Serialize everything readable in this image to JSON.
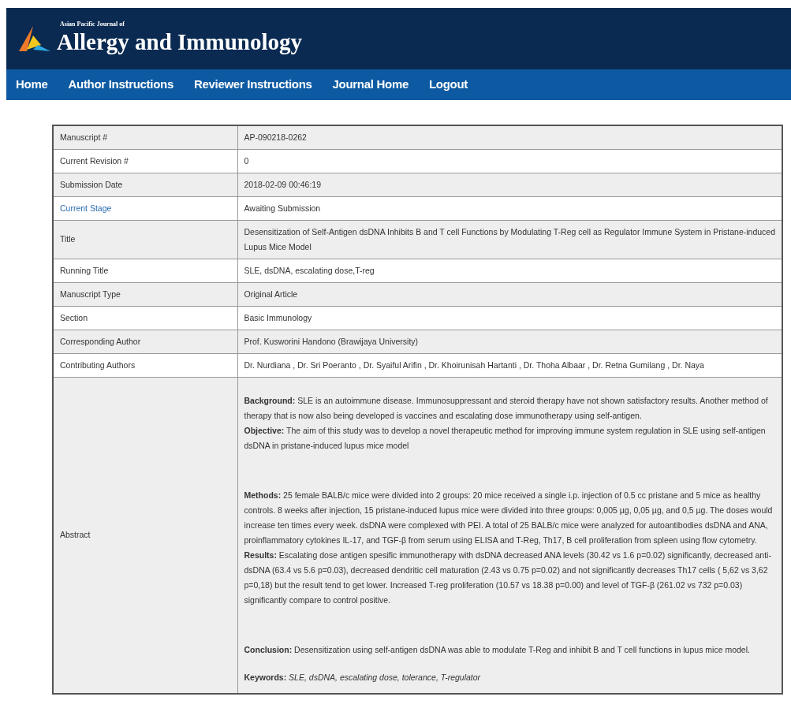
{
  "header": {
    "kicker": "Asian Pacific Journal of",
    "title": "Allergy and Immunology"
  },
  "nav": [
    "Home",
    "Author Instructions",
    "Reviewer Instructions",
    "Journal Home",
    "Logout"
  ],
  "rows": [
    {
      "label": "Manuscript #",
      "kind": "plain",
      "value": "AP-090218-0262"
    },
    {
      "label": "Current Revision #",
      "kind": "plain",
      "value": "0"
    },
    {
      "label": "Submission Date",
      "kind": "plain",
      "value": "2018-02-09 00:46:19"
    },
    {
      "label": "Current Stage",
      "kind": "link",
      "value": "Awaiting Submission"
    },
    {
      "label": "Title",
      "kind": "plain",
      "value": "Desensitization of Self-Antigen dsDNA Inhibits B and T cell Functions by Modulating T-Reg cell as Regulator Immune System in Pristane-induced Lupus Mice Model"
    },
    {
      "label": "Running Title",
      "kind": "plain",
      "value": "SLE, dsDNA, escalating dose,T-reg"
    },
    {
      "label": "Manuscript Type",
      "kind": "plain",
      "value": "Original Article"
    },
    {
      "label": "Section",
      "kind": "plain",
      "value": "Basic Immunology"
    },
    {
      "label": "Corresponding Author",
      "kind": "plain",
      "value": "Prof. Kusworini Handono (Brawijaya University)"
    },
    {
      "label": "Contributing Authors",
      "kind": "plain",
      "value": "Dr. Nurdiana , Dr. Sri Poeranto , Dr. Syaiful Arifin , Dr. Khoirunisah Hartanti , Dr. Thoha Albaar , Dr. Retna Gumilang , Dr. Naya"
    }
  ],
  "abstract": {
    "label": "Abstract",
    "blocks": [
      [
        "**Background:** SLE is an autoimmune disease. Immunosuppressant and steroid therapy have not shown satisfactory results. Another method of therapy that is now also being developed is vaccines and escalating dose immunotherapy using self-antigen.",
        "**Objective:** The aim of this study was to develop a novel therapeutic method for improving immune system regulation in SLE using self-antigen dsDNA in pristane-induced lupus mice model"
      ],
      [
        "**Methods:** 25 female BALB/c mice were divided into 2 groups: 20 mice received a single i.p. injection of 0.5 cc pristane and 5 mice as healthy controls. 8 weeks after injection, 15 pristane-induced lupus mice were divided into three groups: 0,005 µg, 0,05 µg, and 0,5 µg. The doses would increase ten times every week. dsDNA were complexed with PEI. A total of 25 BALB/c mice were analyzed for autoantibodies dsDNA and ANA, proinflammatory cytokines IL-17, and TGF-β from serum using ELISA and T-Reg, Th17, B cell proliferation from spleen using flow cytometry.",
        "**Results:** Escalating dose antigen spesific immunotherapy with dsDNA decreased ANA levels (30.42 vs 1.6 p=0.02) significantly, decreased anti-dsDNA (63.4 vs 5.6 p=0.03), decreased dendritic cell maturation (2.43 vs 0.75 p=0.02) and not significantly decreases Th17 cells ( 5,62 vs 3,62 p=0,18) but the result tend to get lower. Increased T-reg proliferation (10.57 vs 18.38 p=0.00) and level of TGF-β (261.02 vs 732 p=0.03) significantly compare to control positive."
      ],
      [
        "**Conclusion:** Desensitization using self-antigen dsDNA was able to modulate T-Reg and inhibit B and T cell functions in lupus mice model."
      ],
      [
        "**Keywords:** *SLE, dsDNA, escalating dose, tolerance, T-regulator*"
      ]
    ]
  }
}
